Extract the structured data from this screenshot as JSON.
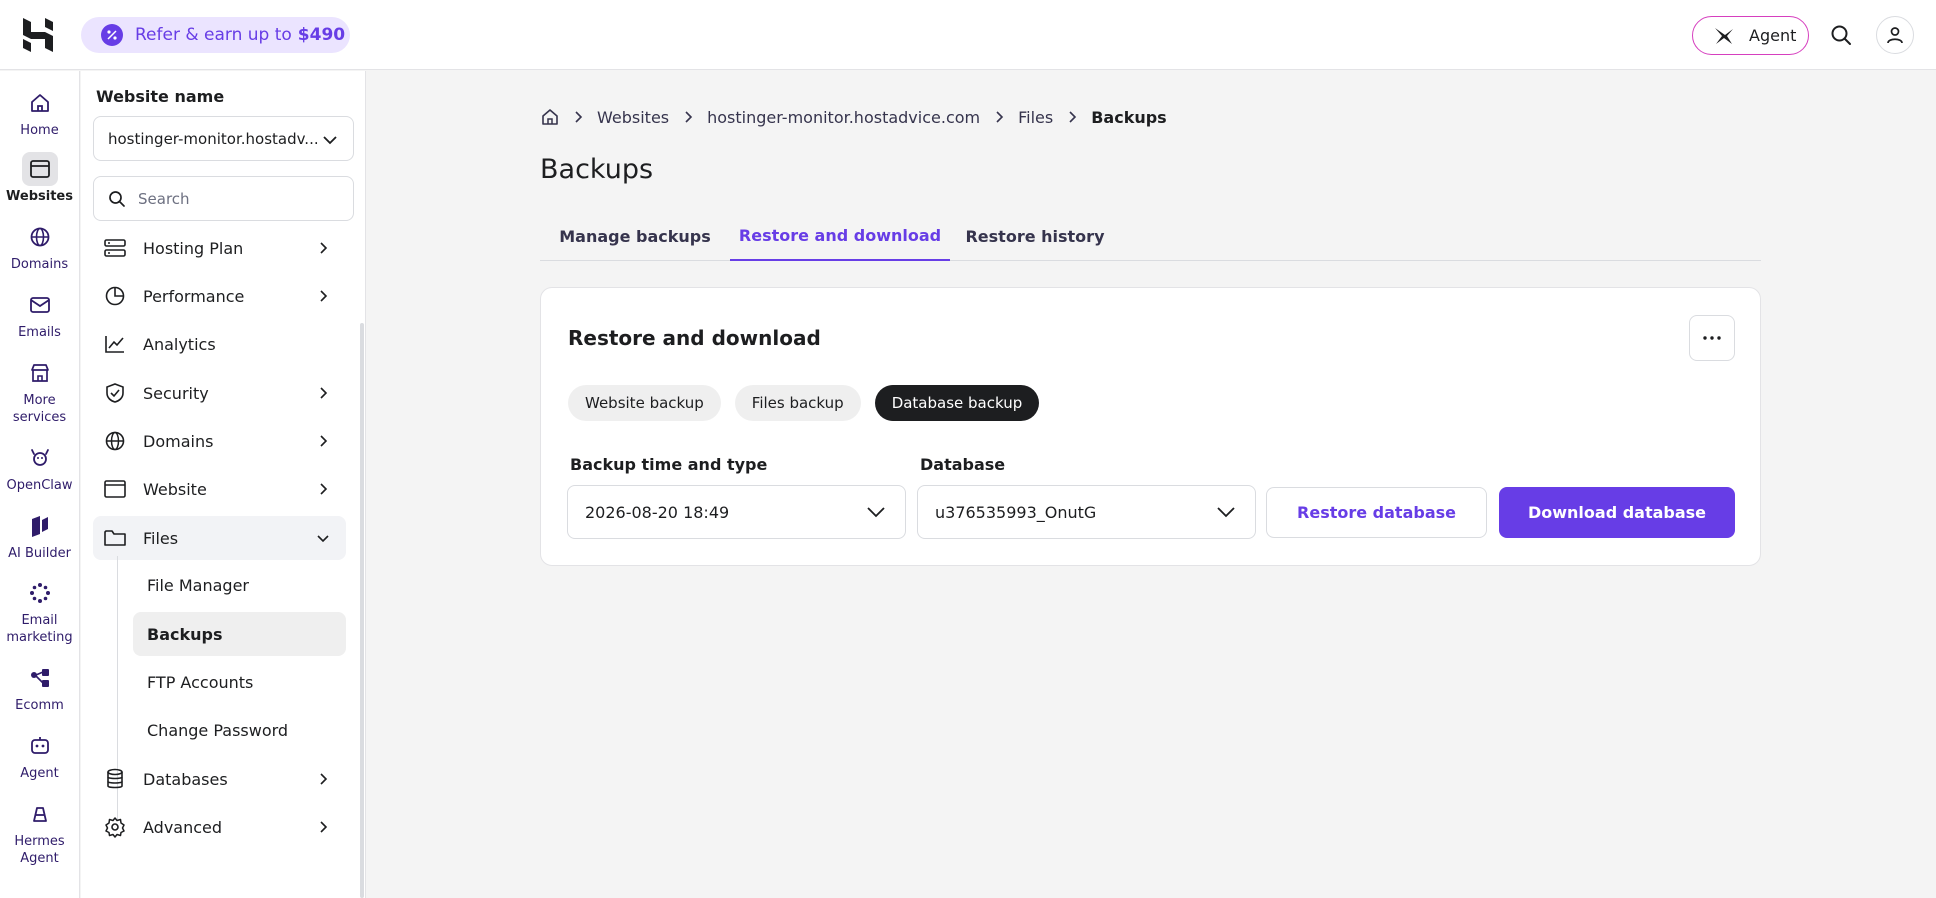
{
  "topbar": {
    "refer_text": "Refer & earn up to",
    "refer_amount": "$490",
    "agent_label": "Agent"
  },
  "rail": {
    "items": [
      {
        "label": "Home",
        "icon": "home-icon"
      },
      {
        "label": "Websites",
        "icon": "browser-window-icon",
        "active": true
      },
      {
        "label": "Domains",
        "icon": "globe-icon"
      },
      {
        "label": "Emails",
        "icon": "envelope-icon"
      },
      {
        "label": "More services",
        "icon": "store-icon"
      },
      {
        "label": "OpenClaw",
        "icon": "claw-icon"
      },
      {
        "label": "AI Builder",
        "icon": "ai-builder-icon"
      },
      {
        "label": "Email marketing",
        "icon": "email-marketing-icon"
      },
      {
        "label": "Ecomm",
        "icon": "ecomm-icon"
      },
      {
        "label": "Agent",
        "icon": "agent-icon"
      },
      {
        "label": "Hermes Agent",
        "icon": "hermes-icon"
      }
    ]
  },
  "sidebar": {
    "title": "Website name",
    "selected_site": "hostinger-monitor.hostadv...",
    "search_placeholder": "Search",
    "items": [
      {
        "label": "Hosting Plan",
        "icon": "server-icon"
      },
      {
        "label": "Performance",
        "icon": "pie-chart-icon"
      },
      {
        "label": "Analytics",
        "icon": "trend-icon"
      },
      {
        "label": "Security",
        "icon": "shield-icon"
      },
      {
        "label": "Domains",
        "icon": "globe-icon"
      },
      {
        "label": "Website",
        "icon": "browser-window-icon"
      },
      {
        "label": "Files",
        "icon": "folder-icon",
        "open": true
      },
      {
        "label": "Databases",
        "icon": "database-icon"
      },
      {
        "label": "Advanced",
        "icon": "gear-icon"
      }
    ],
    "files_sub": [
      {
        "label": "File Manager"
      },
      {
        "label": "Backups",
        "active": true
      },
      {
        "label": "FTP Accounts"
      },
      {
        "label": "Change Password"
      }
    ]
  },
  "breadcrumb": {
    "items": [
      "Websites",
      "hostinger-monitor.hostadvice.com",
      "Files"
    ],
    "current": "Backups"
  },
  "page": {
    "title": "Backups",
    "tabs": [
      {
        "label": "Manage backups"
      },
      {
        "label": "Restore and download",
        "active": true
      },
      {
        "label": "Restore history"
      }
    ]
  },
  "card": {
    "title": "Restore and download",
    "chips": [
      {
        "label": "Website backup"
      },
      {
        "label": "Files backup"
      },
      {
        "label": "Database backup",
        "active": true
      }
    ],
    "backup_label": "Backup time and type",
    "backup_value": "2026-08-20 18:49",
    "database_label": "Database",
    "database_value": "u376535993_OnutG",
    "restore_button": "Restore database",
    "download_button": "Download database"
  },
  "colors": {
    "accent": "#673de6",
    "accent_light": "#ebe4ff",
    "dark": "#1d1e20"
  }
}
